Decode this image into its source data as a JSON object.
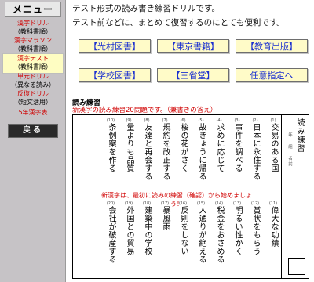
{
  "sidebar": {
    "title": "メニュー",
    "items": [
      {
        "line1": "漢字ドリル",
        "line2": "（教科書順）"
      },
      {
        "line1": "漢字マラソン",
        "line2": "（教科書順）"
      },
      {
        "line1": "漢字テスト",
        "line2": "（教科書順）"
      },
      {
        "line1": "単元ドリル",
        "line2": "（異なる読み）"
      },
      {
        "line1": "反復ドリル",
        "line2": "（短文活用）"
      },
      {
        "line1": "5年漢字表",
        "line2": ""
      }
    ],
    "back_label": "戻る"
  },
  "intro": {
    "line1": "テスト形式の読み書き練習ドリルです。",
    "line2": "テスト前などに、まとめて復習するのにとても便利です。"
  },
  "publishers": {
    "row1": [
      "【光村図書】",
      "【東京書籍】",
      "【教育出版】"
    ],
    "row2": [
      "【学校図書】",
      "【三省堂】",
      "任意指定へ"
    ]
  },
  "section": {
    "title": "読み練習",
    "subtitle": "新漢字の読み練習20問題です。（兼書きの答え）"
  },
  "sheet": {
    "title": "読み練習",
    "meta": "年　組　名前",
    "notice": "新漢字は、最初に読みの練習（確認）から始めましょう！",
    "top": [
      {
        "n": "(1)",
        "t": "交易のある国"
      },
      {
        "n": "(2)",
        "t": "日本に永住する"
      },
      {
        "n": "(3)",
        "t": "事件を調べる"
      },
      {
        "n": "(4)",
        "t": "求めに応じて"
      },
      {
        "n": "(5)",
        "t": "故きょうに帰る"
      },
      {
        "n": "(6)",
        "t": "桜の花がさく"
      },
      {
        "n": "(7)",
        "t": "規約を改正する"
      },
      {
        "n": "(8)",
        "t": "友達と再会する"
      },
      {
        "n": "(9)",
        "t": "量よりも品質"
      },
      {
        "n": "(10)",
        "t": "条例案を作る"
      }
    ],
    "bottom": [
      {
        "n": "(11)",
        "t": "偉大な功績"
      },
      {
        "n": "(12)",
        "t": "賞状をもらう"
      },
      {
        "n": "(13)",
        "t": "明るい性かく"
      },
      {
        "n": "(14)",
        "t": "税金をおさめる"
      },
      {
        "n": "(15)",
        "t": "人通りが絶える"
      },
      {
        "n": "(16)",
        "t": "反則をしない"
      },
      {
        "n": "(17)",
        "t": "暴風雨"
      },
      {
        "n": "(18)",
        "t": "建築中の学校"
      },
      {
        "n": "(19)",
        "t": "外国との貿易"
      },
      {
        "n": "(20)",
        "t": "会社が破産する"
      }
    ]
  }
}
